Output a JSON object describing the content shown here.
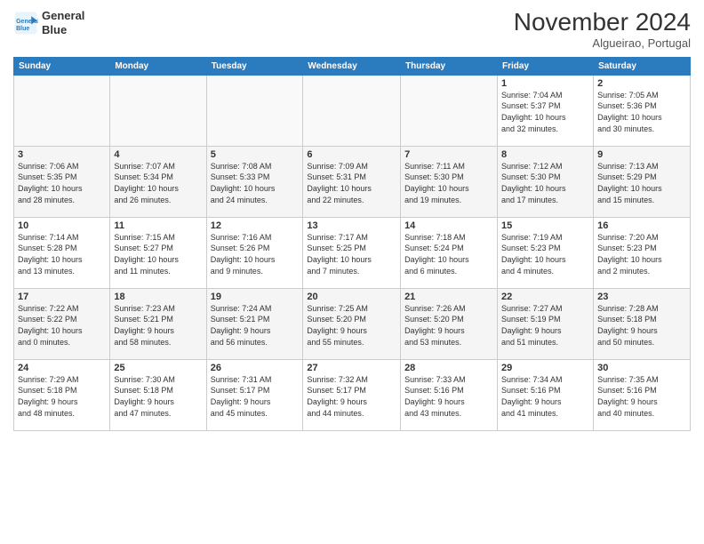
{
  "header": {
    "logo_line1": "General",
    "logo_line2": "Blue",
    "month": "November 2024",
    "location": "Algueirao, Portugal"
  },
  "weekdays": [
    "Sunday",
    "Monday",
    "Tuesday",
    "Wednesday",
    "Thursday",
    "Friday",
    "Saturday"
  ],
  "weeks": [
    [
      {
        "day": "",
        "info": ""
      },
      {
        "day": "",
        "info": ""
      },
      {
        "day": "",
        "info": ""
      },
      {
        "day": "",
        "info": ""
      },
      {
        "day": "",
        "info": ""
      },
      {
        "day": "1",
        "info": "Sunrise: 7:04 AM\nSunset: 5:37 PM\nDaylight: 10 hours\nand 32 minutes."
      },
      {
        "day": "2",
        "info": "Sunrise: 7:05 AM\nSunset: 5:36 PM\nDaylight: 10 hours\nand 30 minutes."
      }
    ],
    [
      {
        "day": "3",
        "info": "Sunrise: 7:06 AM\nSunset: 5:35 PM\nDaylight: 10 hours\nand 28 minutes."
      },
      {
        "day": "4",
        "info": "Sunrise: 7:07 AM\nSunset: 5:34 PM\nDaylight: 10 hours\nand 26 minutes."
      },
      {
        "day": "5",
        "info": "Sunrise: 7:08 AM\nSunset: 5:33 PM\nDaylight: 10 hours\nand 24 minutes."
      },
      {
        "day": "6",
        "info": "Sunrise: 7:09 AM\nSunset: 5:31 PM\nDaylight: 10 hours\nand 22 minutes."
      },
      {
        "day": "7",
        "info": "Sunrise: 7:11 AM\nSunset: 5:30 PM\nDaylight: 10 hours\nand 19 minutes."
      },
      {
        "day": "8",
        "info": "Sunrise: 7:12 AM\nSunset: 5:30 PM\nDaylight: 10 hours\nand 17 minutes."
      },
      {
        "day": "9",
        "info": "Sunrise: 7:13 AM\nSunset: 5:29 PM\nDaylight: 10 hours\nand 15 minutes."
      }
    ],
    [
      {
        "day": "10",
        "info": "Sunrise: 7:14 AM\nSunset: 5:28 PM\nDaylight: 10 hours\nand 13 minutes."
      },
      {
        "day": "11",
        "info": "Sunrise: 7:15 AM\nSunset: 5:27 PM\nDaylight: 10 hours\nand 11 minutes."
      },
      {
        "day": "12",
        "info": "Sunrise: 7:16 AM\nSunset: 5:26 PM\nDaylight: 10 hours\nand 9 minutes."
      },
      {
        "day": "13",
        "info": "Sunrise: 7:17 AM\nSunset: 5:25 PM\nDaylight: 10 hours\nand 7 minutes."
      },
      {
        "day": "14",
        "info": "Sunrise: 7:18 AM\nSunset: 5:24 PM\nDaylight: 10 hours\nand 6 minutes."
      },
      {
        "day": "15",
        "info": "Sunrise: 7:19 AM\nSunset: 5:23 PM\nDaylight: 10 hours\nand 4 minutes."
      },
      {
        "day": "16",
        "info": "Sunrise: 7:20 AM\nSunset: 5:23 PM\nDaylight: 10 hours\nand 2 minutes."
      }
    ],
    [
      {
        "day": "17",
        "info": "Sunrise: 7:22 AM\nSunset: 5:22 PM\nDaylight: 10 hours\nand 0 minutes."
      },
      {
        "day": "18",
        "info": "Sunrise: 7:23 AM\nSunset: 5:21 PM\nDaylight: 9 hours\nand 58 minutes."
      },
      {
        "day": "19",
        "info": "Sunrise: 7:24 AM\nSunset: 5:21 PM\nDaylight: 9 hours\nand 56 minutes."
      },
      {
        "day": "20",
        "info": "Sunrise: 7:25 AM\nSunset: 5:20 PM\nDaylight: 9 hours\nand 55 minutes."
      },
      {
        "day": "21",
        "info": "Sunrise: 7:26 AM\nSunset: 5:20 PM\nDaylight: 9 hours\nand 53 minutes."
      },
      {
        "day": "22",
        "info": "Sunrise: 7:27 AM\nSunset: 5:19 PM\nDaylight: 9 hours\nand 51 minutes."
      },
      {
        "day": "23",
        "info": "Sunrise: 7:28 AM\nSunset: 5:18 PM\nDaylight: 9 hours\nand 50 minutes."
      }
    ],
    [
      {
        "day": "24",
        "info": "Sunrise: 7:29 AM\nSunset: 5:18 PM\nDaylight: 9 hours\nand 48 minutes."
      },
      {
        "day": "25",
        "info": "Sunrise: 7:30 AM\nSunset: 5:18 PM\nDaylight: 9 hours\nand 47 minutes."
      },
      {
        "day": "26",
        "info": "Sunrise: 7:31 AM\nSunset: 5:17 PM\nDaylight: 9 hours\nand 45 minutes."
      },
      {
        "day": "27",
        "info": "Sunrise: 7:32 AM\nSunset: 5:17 PM\nDaylight: 9 hours\nand 44 minutes."
      },
      {
        "day": "28",
        "info": "Sunrise: 7:33 AM\nSunset: 5:16 PM\nDaylight: 9 hours\nand 43 minutes."
      },
      {
        "day": "29",
        "info": "Sunrise: 7:34 AM\nSunset: 5:16 PM\nDaylight: 9 hours\nand 41 minutes."
      },
      {
        "day": "30",
        "info": "Sunrise: 7:35 AM\nSunset: 5:16 PM\nDaylight: 9 hours\nand 40 minutes."
      }
    ]
  ]
}
